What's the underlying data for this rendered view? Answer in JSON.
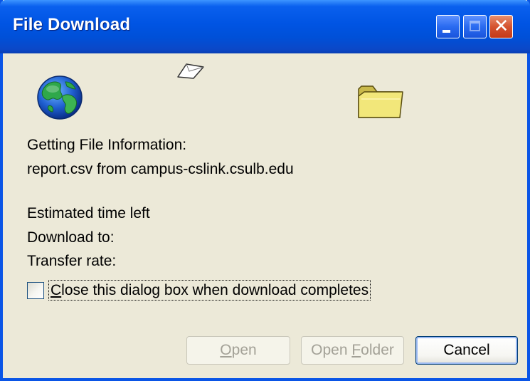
{
  "window": {
    "title": "File Download",
    "controls": {
      "minimize": "minimize",
      "maximize": "maximize",
      "close": "✕"
    }
  },
  "icons": {
    "globe": "globe-icon",
    "paper": "flying-paper-icon",
    "folder": "folder-icon"
  },
  "status": {
    "heading": "Getting File Information:",
    "source": "report.csv from campus-cslink.csulb.edu",
    "time_left_label": "Estimated time left",
    "download_to_label": "Download to:",
    "transfer_rate_label": "Transfer rate:"
  },
  "options": {
    "close_on_complete": {
      "label_first": "C",
      "label_rest": "lose this dialog box when download completes",
      "checked": false
    }
  },
  "buttons": {
    "open": {
      "mnemonic": "O",
      "rest": "pen",
      "enabled": false
    },
    "open_folder": {
      "before": "Open ",
      "mnemonic": "F",
      "rest": "older",
      "enabled": false
    },
    "cancel": {
      "label": "Cancel",
      "enabled": true
    }
  },
  "colors": {
    "titlebar": "#0054e3",
    "dialog_bg": "#ece9d8",
    "close_button": "#d5532f"
  }
}
